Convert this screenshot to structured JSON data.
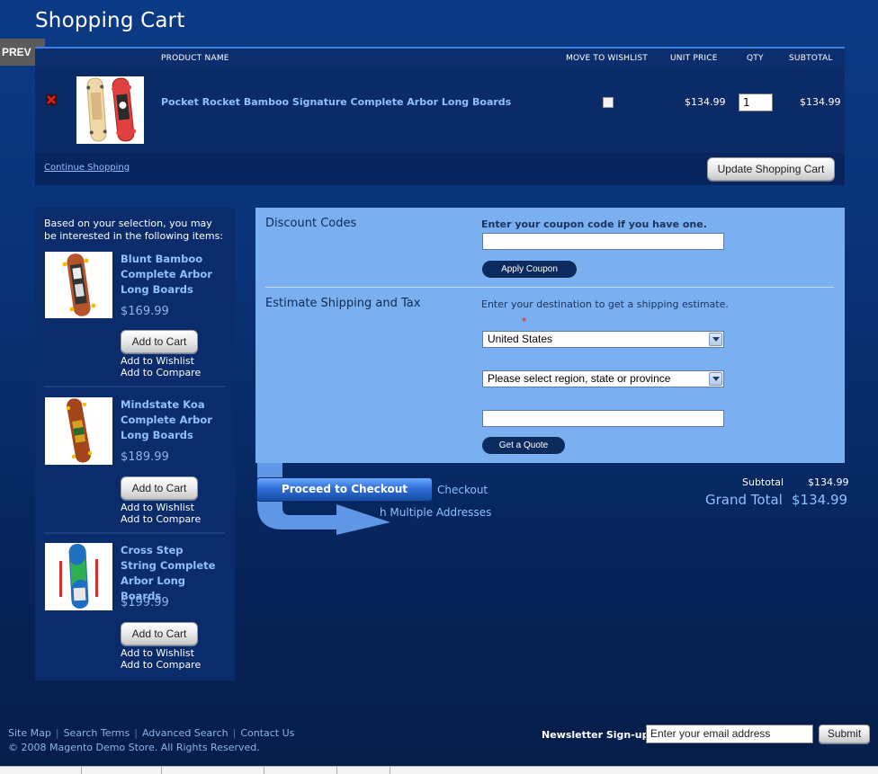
{
  "page": {
    "title": "Shopping Cart",
    "prev_label": "PREV"
  },
  "cart": {
    "headers": {
      "product_name": "PRODUCT NAME",
      "move_to_wishlist": "MOVE TO WISHLIST",
      "unit_price": "UNIT PRICE",
      "qty": "QTY",
      "subtotal": "SUBTOTAL"
    },
    "items": [
      {
        "name": "Pocket Rocket Bamboo Signature Complete Arbor Long Boards",
        "unit_price": "$134.99",
        "qty": "1",
        "subtotal": "$134.99",
        "wishlist_checked": false
      }
    ],
    "continue_label": "Continue Shopping",
    "update_label": "Update Shopping Cart"
  },
  "crosssell": {
    "intro": "Based on your selection, you may be interested in the following items:",
    "items": [
      {
        "name": "Blunt Bamboo Complete Arbor Long Boards",
        "price": "$169.99",
        "add_label": "Add to Cart",
        "wishlist_label": "Add to Wishlist",
        "compare_label": "Add to Compare"
      },
      {
        "name": "Mindstate Koa Complete Arbor Long Boards",
        "price": "$189.99",
        "add_label": "Add to Cart",
        "wishlist_label": "Add to Wishlist",
        "compare_label": "Add to Compare"
      },
      {
        "name": "Cross Step String Complete Arbor Long Boards",
        "price": "$199.99",
        "add_label": "Add to Cart",
        "wishlist_label": "Add to Wishlist",
        "compare_label": "Add to Compare"
      }
    ]
  },
  "discount": {
    "title": "Discount Codes",
    "label": "Enter your coupon code if you have one.",
    "value": "",
    "button": "Apply Coupon"
  },
  "shipping": {
    "title": "Estimate Shipping and Tax",
    "label": "Enter your destination to get a shipping estimate.",
    "required_mark": "*",
    "country": "United States",
    "region": "Please select region, state or province",
    "postcode": "",
    "button": "Get a Quote"
  },
  "checkout": {
    "button": "Proceed to Checkout",
    "checkout_link": "Checkout",
    "multi_link": "h Multiple Addresses"
  },
  "totals": {
    "subtotal_label": "Subtotal",
    "subtotal_value": "$134.99",
    "grand_label": "Grand Total",
    "grand_value": "$134.99"
  },
  "footer": {
    "links": [
      "Site Map",
      "Search Terms",
      "Advanced Search",
      "Contact Us"
    ],
    "copyright": "© 2008 Magento Demo Store. All Rights Reserved.",
    "newsletter_label": "Newsletter Sign-up:",
    "newsletter_placeholder": "Enter your email address",
    "submit_label": "Submit"
  },
  "colors": {
    "background": "#0a3276",
    "accent_link": "#8fc0ff",
    "panel_light": "#7aaff0",
    "checkout_blue": "#2f6fd6"
  },
  "icons": [
    "remove-icon",
    "dropdown-arrow-icon",
    "arrow-decoration-icon"
  ]
}
